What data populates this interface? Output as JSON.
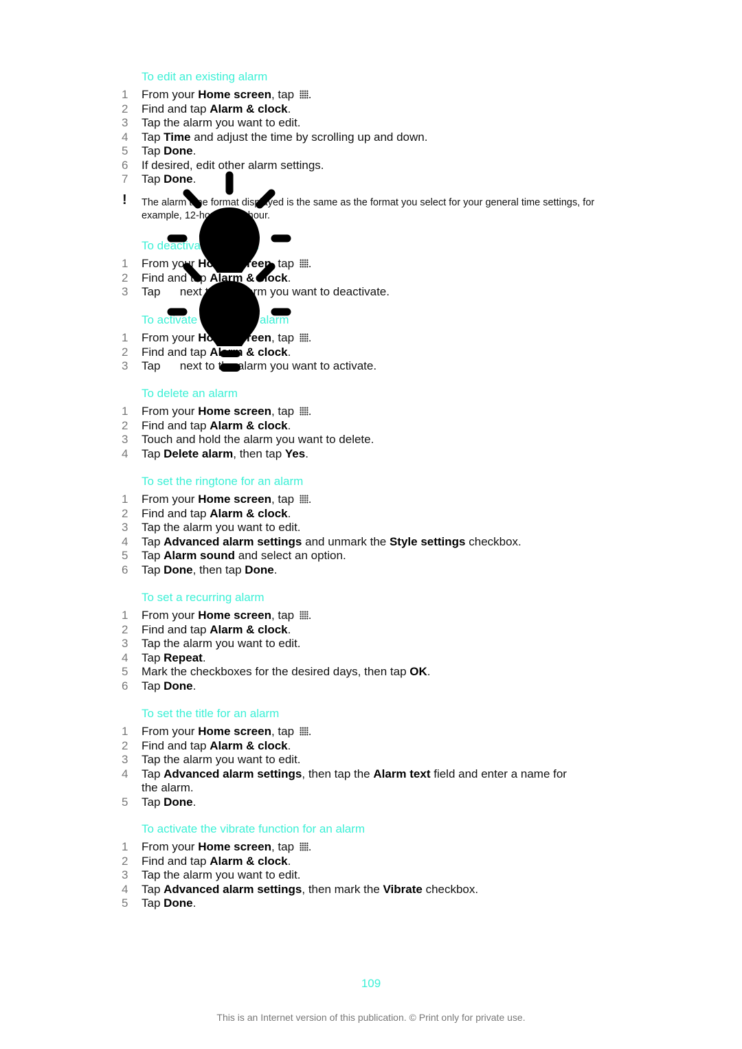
{
  "colors": {
    "heading": "#3cf0d6",
    "step_number": "#777777",
    "footer": "#777777"
  },
  "note": {
    "icon": "exclamation-icon",
    "text": "The alarm time format displayed is the same as the format you select for your general time settings, for example, 12-hour or 24-hour."
  },
  "sections": [
    {
      "heading": "To edit an existing alarm",
      "steps": [
        [
          "From your ",
          {
            "b": "Home screen"
          },
          ", tap ",
          {
            "icon": "apps-icon"
          },
          "."
        ],
        [
          "Find and tap ",
          {
            "b": "Alarm & clock"
          },
          "."
        ],
        [
          "Tap the alarm you want to edit."
        ],
        [
          "Tap ",
          {
            "b": "Time"
          },
          " and adjust the time by scrolling up and down."
        ],
        [
          "Tap ",
          {
            "b": "Done"
          },
          "."
        ],
        [
          "If desired, edit other alarm settings."
        ],
        [
          "Tap ",
          {
            "b": "Done"
          },
          "."
        ]
      ]
    },
    {
      "heading": "To deactivate an alarm",
      "steps": [
        [
          "From your ",
          {
            "b": "Home screen"
          },
          ", tap ",
          {
            "icon": "apps-icon"
          },
          "."
        ],
        [
          "Find and tap ",
          {
            "b": "Alarm & clock"
          },
          "."
        ],
        [
          "Tap      next to the alarm you want to deactivate."
        ]
      ]
    },
    {
      "heading": "To activate an existing alarm",
      "steps": [
        [
          "From your ",
          {
            "b": "Home screen"
          },
          ", tap ",
          {
            "icon": "apps-icon"
          },
          "."
        ],
        [
          "Find and tap ",
          {
            "b": "Alarm & clock"
          },
          "."
        ],
        [
          "Tap      next to the alarm you want to activate."
        ]
      ]
    },
    {
      "heading": "To delete an alarm",
      "steps": [
        [
          "From your ",
          {
            "b": "Home screen"
          },
          ", tap ",
          {
            "icon": "apps-icon"
          },
          "."
        ],
        [
          "Find and tap ",
          {
            "b": "Alarm & clock"
          },
          "."
        ],
        [
          "Touch and hold the alarm you want to delete."
        ],
        [
          "Tap ",
          {
            "b": "Delete alarm"
          },
          ", then tap ",
          {
            "b": "Yes"
          },
          "."
        ]
      ]
    },
    {
      "heading": "To set the ringtone for an alarm",
      "steps": [
        [
          "From your ",
          {
            "b": "Home screen"
          },
          ", tap ",
          {
            "icon": "apps-icon"
          },
          "."
        ],
        [
          "Find and tap ",
          {
            "b": "Alarm & clock"
          },
          "."
        ],
        [
          "Tap the alarm you want to edit."
        ],
        [
          "Tap ",
          {
            "b": "Advanced alarm settings"
          },
          " and unmark the ",
          {
            "b": "Style settings"
          },
          " checkbox."
        ],
        [
          "Tap ",
          {
            "b": "Alarm sound"
          },
          " and select an option."
        ],
        [
          "Tap ",
          {
            "b": "Done"
          },
          ", then tap ",
          {
            "b": "Done"
          },
          "."
        ]
      ]
    },
    {
      "heading": "To set a recurring alarm",
      "steps": [
        [
          "From your ",
          {
            "b": "Home screen"
          },
          ", tap ",
          {
            "icon": "apps-icon"
          },
          "."
        ],
        [
          "Find and tap ",
          {
            "b": "Alarm & clock"
          },
          "."
        ],
        [
          "Tap the alarm you want to edit."
        ],
        [
          "Tap ",
          {
            "b": "Repeat"
          },
          "."
        ],
        [
          "Mark the checkboxes for the desired days, then tap ",
          {
            "b": "OK"
          },
          "."
        ],
        [
          "Tap ",
          {
            "b": "Done"
          },
          "."
        ]
      ]
    },
    {
      "heading": "To set the title for an alarm",
      "steps": [
        [
          "From your ",
          {
            "b": "Home screen"
          },
          ", tap ",
          {
            "icon": "apps-icon"
          },
          "."
        ],
        [
          "Find and tap ",
          {
            "b": "Alarm & clock"
          },
          "."
        ],
        [
          "Tap the alarm you want to edit."
        ],
        [
          "Tap ",
          {
            "b": "Advanced alarm settings"
          },
          ", then tap the ",
          {
            "b": "Alarm text"
          },
          " field and enter a name for the alarm."
        ],
        [
          "Tap ",
          {
            "b": "Done"
          },
          "."
        ]
      ]
    },
    {
      "heading": "To activate the vibrate function for an alarm",
      "steps": [
        [
          "From your ",
          {
            "b": "Home screen"
          },
          ", tap ",
          {
            "icon": "apps-icon"
          },
          "."
        ],
        [
          "Find and tap ",
          {
            "b": "Alarm & clock"
          },
          "."
        ],
        [
          "Tap the alarm you want to edit."
        ],
        [
          "Tap ",
          {
            "b": "Advanced alarm settings"
          },
          ", then mark the ",
          {
            "b": "Vibrate"
          },
          " checkbox."
        ],
        [
          "Tap ",
          {
            "b": "Done"
          },
          "."
        ]
      ]
    }
  ],
  "page_number": "109",
  "footer": "This is an Internet version of this publication. © Print only for private use."
}
